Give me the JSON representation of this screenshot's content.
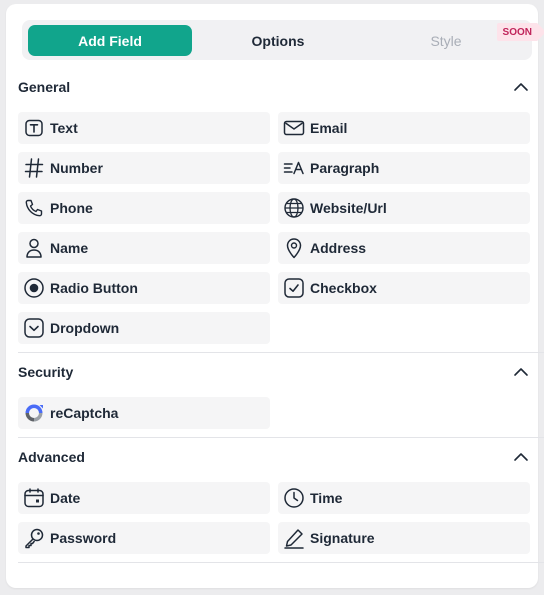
{
  "tabs": {
    "add_field": "Add Field",
    "options": "Options",
    "style": "Style",
    "soon_badge": "SOON"
  },
  "sections": {
    "general": {
      "title": "General",
      "fields": {
        "text": "Text",
        "email": "Email",
        "number": "Number",
        "paragraph": "Paragraph",
        "phone": "Phone",
        "website": "Website/Url",
        "name": "Name",
        "address": "Address",
        "radio": "Radio Button",
        "checkbox": "Checkbox",
        "dropdown": "Dropdown"
      }
    },
    "security": {
      "title": "Security",
      "fields": {
        "recaptcha": "reCaptcha"
      }
    },
    "advanced": {
      "title": "Advanced",
      "fields": {
        "date": "Date",
        "time": "Time",
        "password": "Password",
        "signature": "Signature"
      }
    }
  },
  "colors": {
    "accent": "#11a58c",
    "soon_badge": "#c0245a",
    "field_bg": "#f5f5f6"
  },
  "icons": [
    "text-icon",
    "email-icon",
    "number-icon",
    "paragraph-icon",
    "phone-icon",
    "globe-icon",
    "user-icon",
    "location-pin-icon",
    "radio-icon",
    "checkbox-icon",
    "dropdown-icon",
    "recaptcha-icon",
    "calendar-icon",
    "clock-icon",
    "key-icon",
    "pen-icon",
    "chevron-up-icon"
  ]
}
